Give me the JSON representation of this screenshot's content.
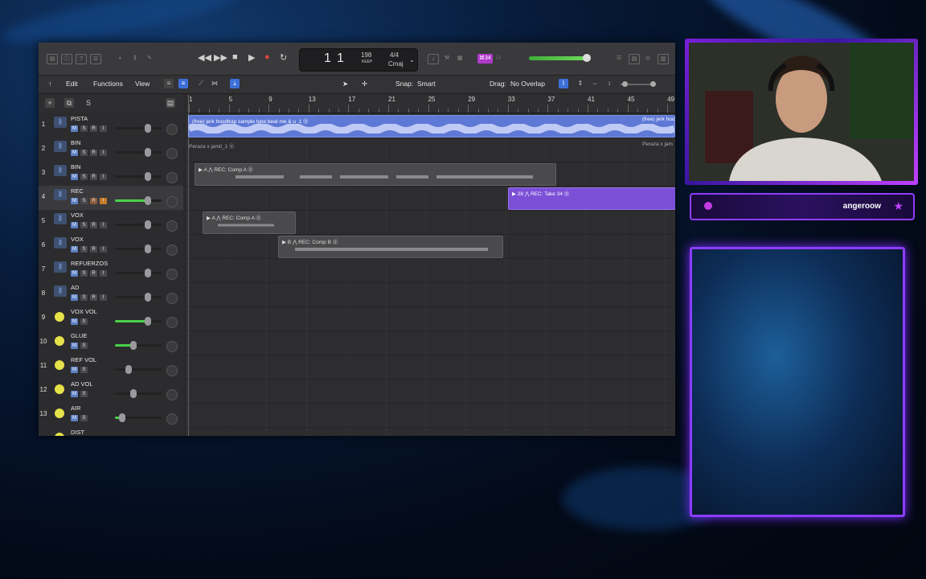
{
  "daw": {
    "transport": {
      "position_bar": "1",
      "position_beat": "1",
      "tempo": "198",
      "tempo_label": "KEEP",
      "time_signature": "4/4",
      "key": "Cmaj",
      "badge": "⌘34"
    },
    "edit_bar": {
      "edit_menu": "Edit",
      "functions_menu": "Functions",
      "view_menu": "View",
      "snap_label": "Snap:",
      "snap_value": "Smart",
      "drag_label": "Drag:",
      "drag_value": "No Overlap"
    },
    "ruler": [
      "1",
      "5",
      "9",
      "13",
      "17",
      "21",
      "25",
      "29",
      "33",
      "37",
      "41",
      "45",
      "49"
    ],
    "tracks": [
      {
        "num": "1",
        "name": "PISTA",
        "kind": "audio"
      },
      {
        "num": "2",
        "name": "BIN",
        "kind": "audio"
      },
      {
        "num": "3",
        "name": "BIN",
        "kind": "audio"
      },
      {
        "num": "4",
        "name": "REC",
        "kind": "audio"
      },
      {
        "num": "5",
        "name": "VOX",
        "kind": "audio"
      },
      {
        "num": "6",
        "name": "VOX",
        "kind": "audio"
      },
      {
        "num": "7",
        "name": "REFUERZOS",
        "kind": "audio"
      },
      {
        "num": "8",
        "name": "AD",
        "kind": "audio"
      },
      {
        "num": "9",
        "name": "VOX VOL",
        "kind": "aux"
      },
      {
        "num": "10",
        "name": "GLUE",
        "kind": "aux"
      },
      {
        "num": "11",
        "name": "REF VOL",
        "kind": "aux"
      },
      {
        "num": "12",
        "name": "AD VOL",
        "kind": "aux"
      },
      {
        "num": "13",
        "name": "AIR",
        "kind": "aux"
      },
      {
        "num": "",
        "name": "DIST",
        "kind": "aux"
      }
    ],
    "regions": {
      "pista_title": "(free) jerk hoodtrap sample type beat me & u_1 ⓪",
      "pista_title_right": "(free) jerk hoo",
      "pista_sub": "Peraza x jamil_1 ⓪",
      "pista_sub_right": "Peraza x jam",
      "rec_comp_a": "▶ A ⋀ REC: Comp A ⓪",
      "rec_take": "▶ 28 ⋀ REC: Take 34 ⓪",
      "vox_comp_a": "▶ A ⋀ REC: Comp A ⓪",
      "vox_comp_b": "▶ B ⋀ REC: Comp B ⓪"
    }
  },
  "stream": {
    "username": "angeroow"
  },
  "colors": {
    "accent_blue": "#5e78d6",
    "accent_purple": "#7b4fd6",
    "frame_purple": "#8b3dff",
    "aux_yellow": "#e6e24a"
  }
}
